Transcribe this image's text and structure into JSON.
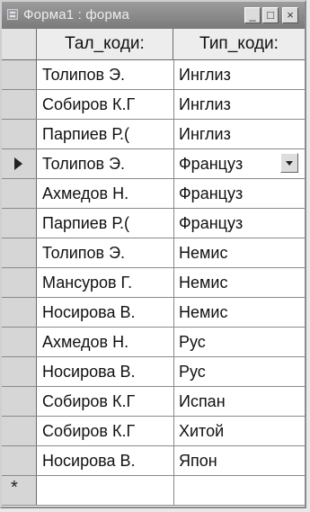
{
  "window": {
    "title": "Форма1 : форма",
    "controls": {
      "minimize": "_",
      "maximize": "□",
      "close": "×"
    }
  },
  "table": {
    "columns": [
      "Тал_коди:",
      "Тип_коди:"
    ],
    "rows": [
      [
        "Толипов Э.",
        "Инглиз"
      ],
      [
        "Собиров К.Г",
        "Инглиз"
      ],
      [
        "Парпиев Р.(",
        "Инглиз"
      ],
      [
        "Толипов Э.",
        "Француз"
      ],
      [
        "Ахмедов Н.",
        "Француз"
      ],
      [
        "Парпиев Р.(",
        "Француз"
      ],
      [
        "Толипов Э.",
        "Немис"
      ],
      [
        "Мансуров Г.",
        "Немис"
      ],
      [
        "Носирова В.",
        "Немис"
      ],
      [
        "Ахмедов Н.",
        "Рус"
      ],
      [
        "Носирова В.",
        "Рус"
      ],
      [
        "Собиров К.Г",
        "Испан"
      ],
      [
        "Собиров К.Г",
        "Хитой"
      ],
      [
        "Носирова В.",
        "Япон"
      ]
    ],
    "current_row_index": 3,
    "new_record_marker": "*"
  },
  "icons": {
    "window_icon": "form-icon",
    "current_record": "triangle-right-icon",
    "dropdown": "chevron-down-icon"
  }
}
